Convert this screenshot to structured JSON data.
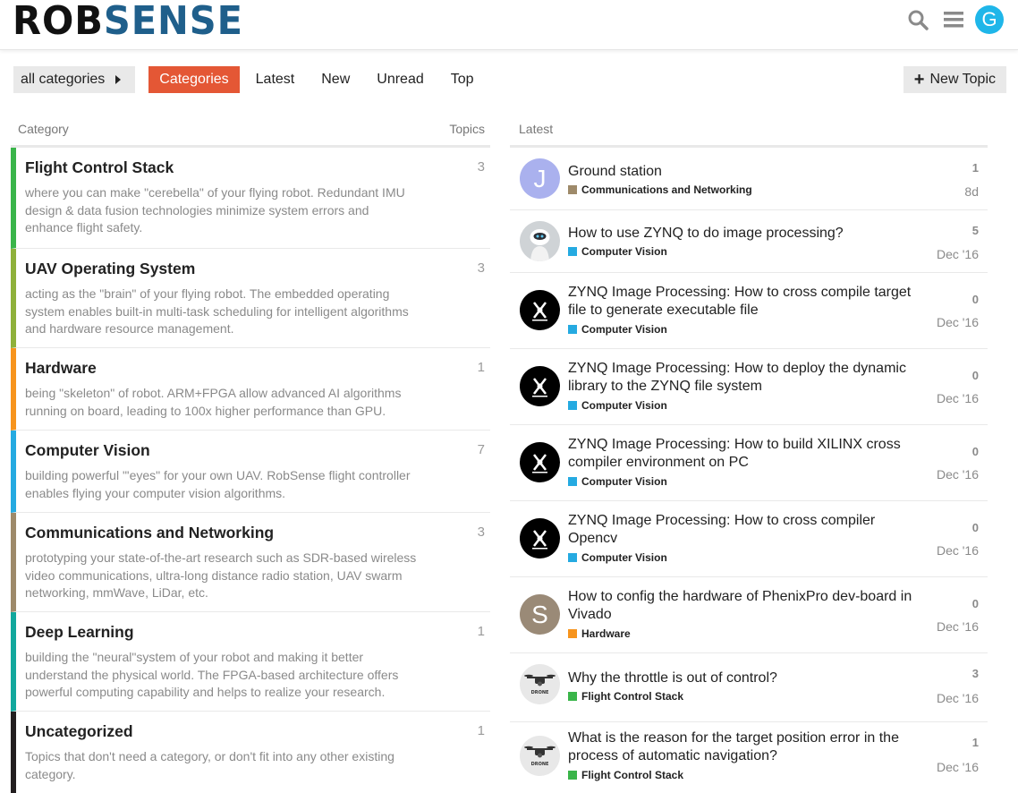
{
  "brand": {
    "logo_text": "ROBSENSE",
    "user_initial": "G"
  },
  "header_icons": [
    "search-icon",
    "hamburger-icon"
  ],
  "nav": {
    "category_dropdown": "all categories",
    "tabs": [
      "Categories",
      "Latest",
      "New",
      "Unread",
      "Top"
    ],
    "active_tab": "Categories",
    "new_topic": "New Topic"
  },
  "colors": {
    "accent": "#e45735",
    "flight_control": "#3ab54a",
    "uav_os": "#8fb13b",
    "hardware": "#f7941d",
    "computer_vision": "#25aae1",
    "communications": "#9e8a6a",
    "deep_learning": "#12a89d",
    "uncategorized": "#231f20"
  },
  "categories": {
    "header": {
      "category": "Category",
      "topics": "Topics"
    },
    "items": [
      {
        "name": "Flight Control Stack",
        "count": "3",
        "description": "where you can make \"cerebella\" of your flying robot. Redundant IMU design & data fusion technologies minimize system errors and enhance flight safety."
      },
      {
        "name": "UAV Operating System",
        "count": "3",
        "description": "acting as the \"brain\" of your flying robot. The embedded operating system enables built-in multi-task scheduling for intelligent algorithms and hardware resource management."
      },
      {
        "name": "Hardware",
        "count": "1",
        "description": "being \"skeleton\" of robot. ARM+FPGA allow advanced AI algorithms running on board, leading to 100x higher performance than GPU."
      },
      {
        "name": "Computer Vision",
        "count": "7",
        "description": "building powerful \"'eyes\" for your own UAV. RobSense flight controller enables flying your computer vision algorithms."
      },
      {
        "name": "Communications and Networking",
        "count": "3",
        "description": "prototyping your state-of-the-art research such as SDR-based wireless video communications, ultra-long distance radio station, UAV swarm networking, mmWave, LiDar, etc."
      },
      {
        "name": "Deep Learning",
        "count": "1",
        "description": "building the \"neural\"system of your robot and making it better understand the physical world. The FPGA-based architecture offers powerful computing capability and helps to realize your research."
      },
      {
        "name": "Uncategorized",
        "count": "1",
        "description": "Topics that don't need a category, or don't fit into any other existing category."
      }
    ]
  },
  "latest": {
    "header": "Latest",
    "topics": [
      {
        "title": "Ground station",
        "category": "Communications and Networking",
        "replies": "1",
        "date": "8d",
        "avatar": "J"
      },
      {
        "title": "How to use ZYNQ to do image processing?",
        "category": "Computer Vision",
        "replies": "5",
        "date": "Dec '16",
        "avatar": "robot-avatar"
      },
      {
        "title": "ZYNQ Image Processing: How to cross compile target file to generate executable file",
        "category": "Computer Vision",
        "replies": "0",
        "date": "Dec '16",
        "avatar": "drone-logo-avatar"
      },
      {
        "title": "ZYNQ Image Processing: How to deploy the dynamic library to the ZYNQ file system",
        "category": "Computer Vision",
        "replies": "0",
        "date": "Dec '16",
        "avatar": "drone-logo-avatar"
      },
      {
        "title": "ZYNQ Image Processing: How to build XILINX cross compiler environment on PC",
        "category": "Computer Vision",
        "replies": "0",
        "date": "Dec '16",
        "avatar": "drone-logo-avatar"
      },
      {
        "title": "ZYNQ Image Processing: How to cross compiler Opencv",
        "category": "Computer Vision",
        "replies": "0",
        "date": "Dec '16",
        "avatar": "drone-logo-avatar"
      },
      {
        "title": "How to config the hardware of PhenixPro dev-board in Vivado",
        "category": "Hardware",
        "replies": "0",
        "date": "Dec '16",
        "avatar": "S"
      },
      {
        "title": "Why the throttle is out of control?",
        "category": "Flight Control Stack",
        "replies": "3",
        "date": "Dec '16",
        "avatar": "drone-avatar",
        "avatar_text": "DRONE"
      },
      {
        "title": "What is the reason for the target position error in the process of automatic navigation?",
        "category": "Flight Control Stack",
        "replies": "1",
        "date": "Dec '16",
        "avatar": "drone-avatar",
        "avatar_text": "DRONE"
      }
    ]
  }
}
